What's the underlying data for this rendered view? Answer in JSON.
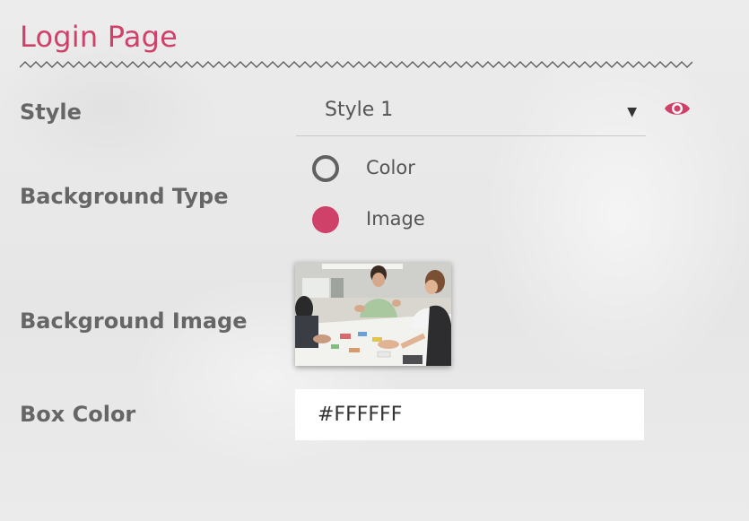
{
  "page": {
    "title": "Login Page"
  },
  "form": {
    "style": {
      "label": "Style",
      "selected": "Style 1",
      "preview_icon": "eye-icon"
    },
    "background_type": {
      "label": "Background Type",
      "options": [
        {
          "label": "Color",
          "selected": false
        },
        {
          "label": "Image",
          "selected": true
        }
      ]
    },
    "background_image": {
      "label": "Background Image"
    },
    "box_color": {
      "label": "Box Color",
      "value": "#FFFFFF"
    }
  },
  "colors": {
    "accent": "#d0416a",
    "label": "#666666",
    "background": "#eaeaea"
  }
}
